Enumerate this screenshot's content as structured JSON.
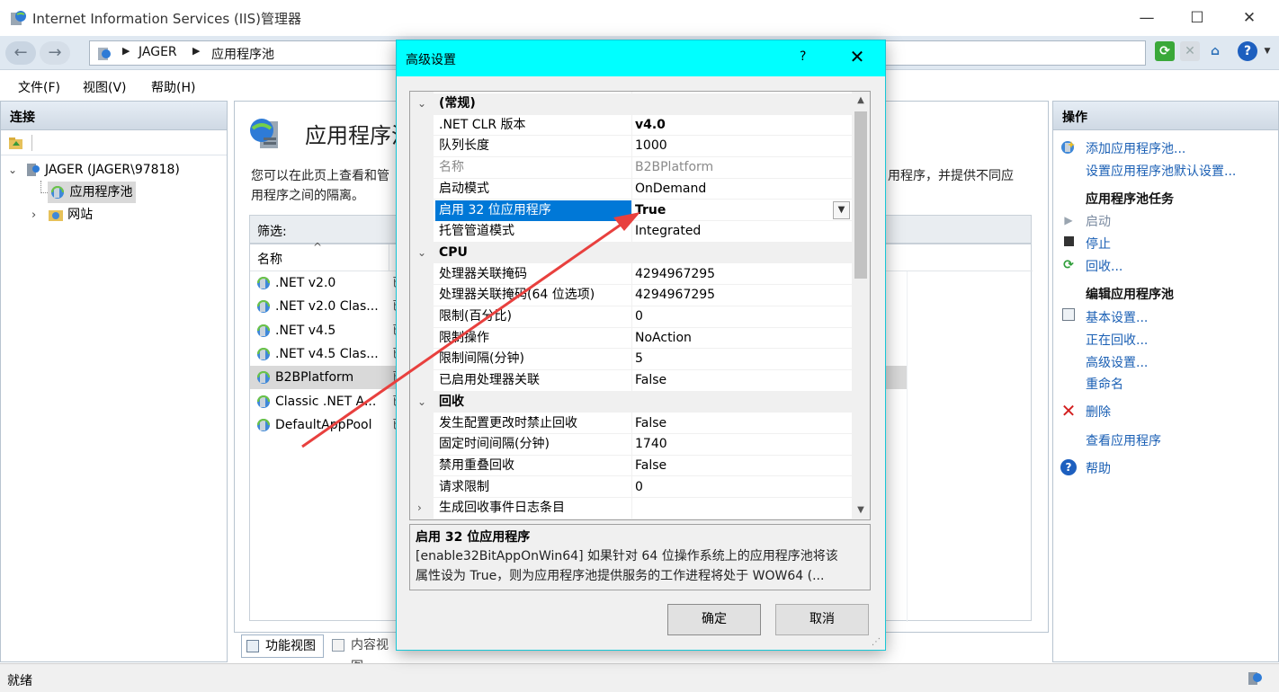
{
  "window": {
    "title": "Internet Information Services (IIS)管理器",
    "minimize": "—",
    "maximize": "☐",
    "close": "✕"
  },
  "address": {
    "back": "←",
    "forward": "→",
    "crumbs": [
      "JAGER",
      "应用程序池"
    ],
    "sep": "▶"
  },
  "menu": [
    "文件(F)",
    "视图(V)",
    "帮助(H)"
  ],
  "connections": {
    "header": "连接",
    "tree": [
      {
        "label": "JAGER (JAGER\\97818)",
        "expander": "⌄"
      },
      {
        "label": "应用程序池"
      },
      {
        "label": "网站",
        "expander": "›"
      }
    ]
  },
  "center": {
    "heading": "应用程序池",
    "description_left": "您可以在此页上查看和管",
    "description_right": "用程序，并提供不同应",
    "description_line2": "用程序之间的隔离。",
    "filter_label": "筛选:",
    "column_name": "名称",
    "sort_indicator": "^",
    "pools": [
      {
        "name": ".NET v2.0",
        "status": "已"
      },
      {
        "name": ".NET v2.0 Clas...",
        "status": "已"
      },
      {
        "name": ".NET v4.5",
        "status": "已"
      },
      {
        "name": ".NET v4.5 Clas...",
        "status": "已"
      },
      {
        "name": "B2BPlatform",
        "status": "已",
        "selected": true
      },
      {
        "name": "Classic .NET A...",
        "status": "已"
      },
      {
        "name": "DefaultAppPool",
        "status": "已"
      }
    ],
    "view_tabs": [
      "功能视图",
      "内容视图"
    ]
  },
  "actions": {
    "header": "操作",
    "add_pool": "添加应用程序池...",
    "set_defaults": "设置应用程序池默认设置...",
    "tasks_header": "应用程序池任务",
    "start": "启动",
    "stop": "停止",
    "recycle": "回收...",
    "edit_header": "编辑应用程序池",
    "basic_settings": "基本设置...",
    "recycling": "正在回收...",
    "advanced_settings": "高级设置...",
    "rename": "重命名",
    "delete": "删除",
    "view_apps": "查看应用程序",
    "help": "帮助"
  },
  "status": {
    "text": "就绪"
  },
  "dialog": {
    "title": "高级设置",
    "help": "?",
    "close": "✕",
    "rows": [
      {
        "label": "(常规)",
        "value": "",
        "type": "cat",
        "chev": "⌄"
      },
      {
        "label": ".NET CLR 版本",
        "value": "v4.0",
        "type": "bold"
      },
      {
        "label": "队列长度",
        "value": "1000"
      },
      {
        "label": "名称",
        "value": "B2BPlatform",
        "type": "grey"
      },
      {
        "label": "启动模式",
        "value": "OnDemand"
      },
      {
        "label": "启用 32 位应用程序",
        "value": "True",
        "type": "selected"
      },
      {
        "label": "托管管道模式",
        "value": "Integrated"
      },
      {
        "label": "CPU",
        "value": "",
        "type": "cat",
        "chev": "⌄"
      },
      {
        "label": "处理器关联掩码",
        "value": "4294967295"
      },
      {
        "label": "处理器关联掩码(64 位选项)",
        "value": "4294967295"
      },
      {
        "label": "限制(百分比)",
        "value": "0"
      },
      {
        "label": "限制操作",
        "value": "NoAction"
      },
      {
        "label": "限制间隔(分钟)",
        "value": "5"
      },
      {
        "label": "已启用处理器关联",
        "value": "False"
      },
      {
        "label": "回收",
        "value": "",
        "type": "cat",
        "chev": "⌄"
      },
      {
        "label": "发生配置更改时禁止回收",
        "value": "False"
      },
      {
        "label": "固定时间间隔(分钟)",
        "value": "1740"
      },
      {
        "label": "禁用重叠回收",
        "value": "False"
      },
      {
        "label": "请求限制",
        "value": "0"
      },
      {
        "label": "生成回收事件日志条目",
        "value": "",
        "chev": "›"
      }
    ],
    "desc_title": "启用 32 位应用程序",
    "desc_line1": "[enable32BitAppOnWin64] 如果针对 64 位操作系统上的应用程序池将该",
    "desc_line2": "属性设为 True，则为应用程序池提供服务的工作进程将处于 WOW64 (...",
    "ok": "确定",
    "cancel": "取消"
  },
  "colors": {
    "dialog_title_bg": "#00ffff",
    "selection": "#0078d7",
    "link": "#1a5fb4",
    "annotation_arrow": "#e8403e"
  }
}
